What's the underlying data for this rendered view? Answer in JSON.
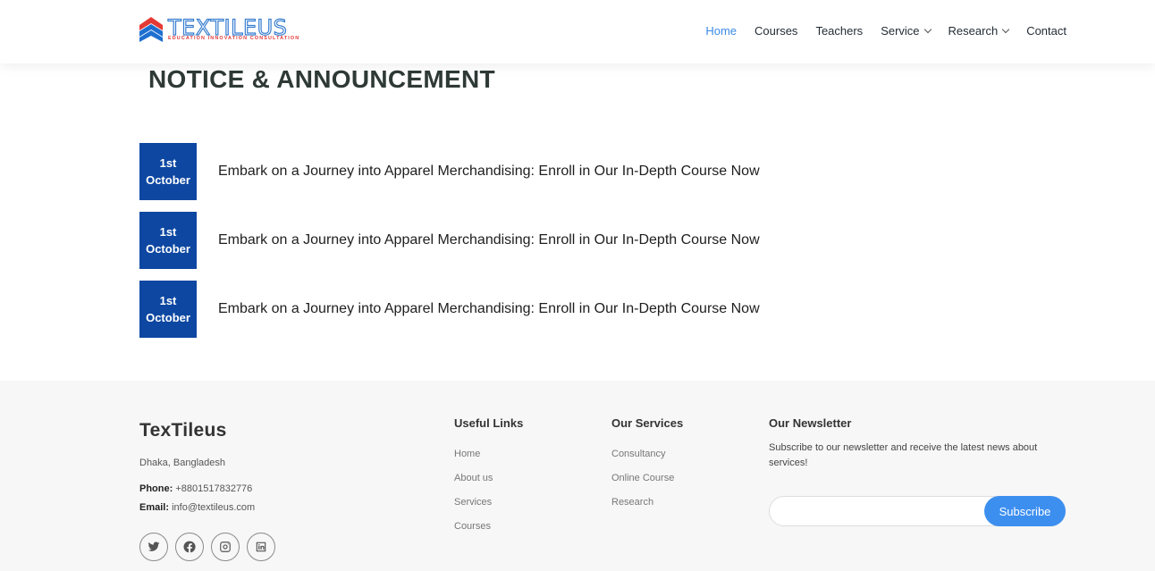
{
  "logo": {
    "text": "TEXTILEUS",
    "tagline": "EDUCATION INNOVATION CONSULTATION"
  },
  "nav": [
    {
      "label": "Home",
      "active": true,
      "dropdown": false
    },
    {
      "label": "Courses",
      "active": false,
      "dropdown": false
    },
    {
      "label": "Teachers",
      "active": false,
      "dropdown": false
    },
    {
      "label": "Service",
      "active": false,
      "dropdown": true
    },
    {
      "label": "Research",
      "active": false,
      "dropdown": true
    },
    {
      "label": "Contact",
      "active": false,
      "dropdown": false
    }
  ],
  "page_title": "NOTICE & ANNOUNCEMENT",
  "notices": [
    {
      "day": "1st",
      "month": "October",
      "text": "Embark on a Journey into Apparel Merchandising: Enroll in Our In-Depth Course Now"
    },
    {
      "day": "1st",
      "month": "October",
      "text": "Embark on a Journey into Apparel Merchandising: Enroll in Our In-Depth Course Now"
    },
    {
      "day": "1st",
      "month": "October",
      "text": "Embark on a Journey into Apparel Merchandising: Enroll in Our In-Depth Course Now"
    }
  ],
  "footer": {
    "brand": "TexTileus",
    "address": "Dhaka, Bangladesh",
    "phone_label": "Phone:",
    "phone": "+8801517832776",
    "email_label": "Email:",
    "email": "info@textileus.com",
    "socials": [
      "twitter-icon",
      "facebook-icon",
      "instagram-icon",
      "linkedin-icon"
    ],
    "useful_links": {
      "heading": "Useful Links",
      "items": [
        "Home",
        "About us",
        "Services",
        "Courses"
      ]
    },
    "services": {
      "heading": "Our Services",
      "items": [
        "Consultancy",
        "Online Course",
        "Research"
      ]
    },
    "newsletter": {
      "heading": "Our Newsletter",
      "text": "Subscribe to our newsletter and receive the latest news about services!",
      "input_value": "",
      "button": "Subscribe"
    }
  },
  "colors": {
    "accent": "#3d8fef",
    "date_box": "#0d47a1",
    "nav_active": "#3b8ae6",
    "footer_bg": "#f7f7f7"
  }
}
